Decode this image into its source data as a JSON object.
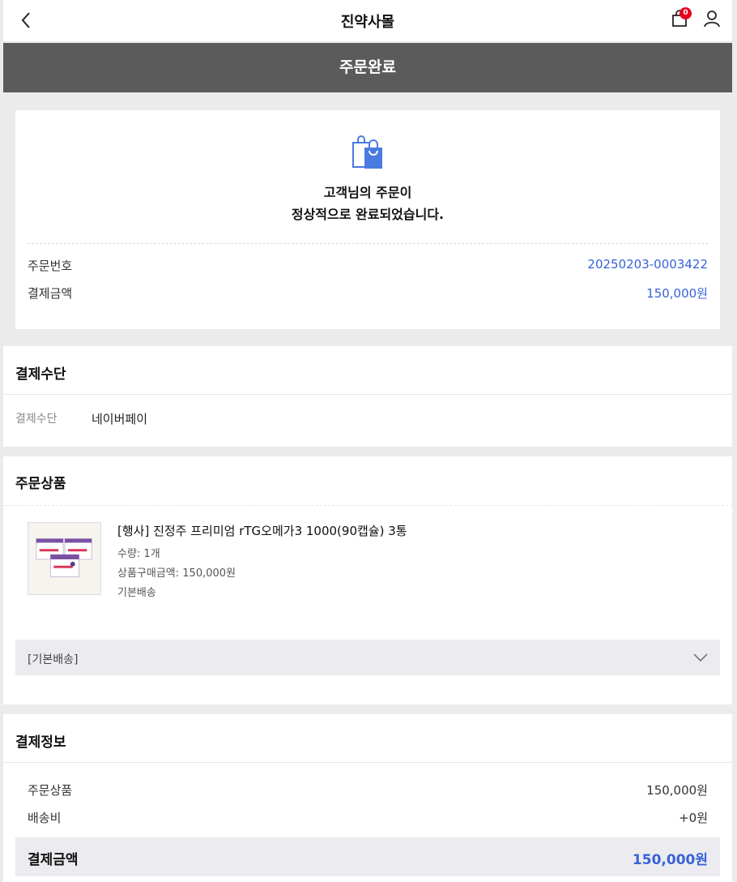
{
  "header": {
    "title": "진약사몰",
    "cart_count": "0"
  },
  "banner": {
    "title": "주문완료"
  },
  "receipt": {
    "message_line1": "고객님의 주문이",
    "message_line2": "정상적으로 완료되었습니다.",
    "order_no_label": "주문번호",
    "order_no": "20250203-0003422",
    "amount_label": "결제금액",
    "amount": "150,000원"
  },
  "payment": {
    "title": "결제수단",
    "label": "결제수단",
    "value": "네이버페이"
  },
  "products": {
    "title": "주문상품",
    "item": {
      "name": "[행사] 진정주 프리미엄 rTG오메가3 1000(90캡슐) 3통",
      "quantity": "수량: 1개",
      "price": "상품구매금액: 150,000원",
      "shipping": "기본배송"
    },
    "shipping_group": "[기본배송]"
  },
  "summary": {
    "title": "결제정보",
    "rows": [
      {
        "label": "주문상품",
        "value": "150,000원"
      },
      {
        "label": "배송비",
        "value": "+0원"
      }
    ],
    "total_label": "결제금액",
    "total_value": "150,000원"
  },
  "colors": {
    "accent": "#3763d8",
    "banner": "#5b5b5b",
    "badge": "#e8001c"
  },
  "icons": [
    "back-arrow-icon",
    "cart-icon",
    "user-icon",
    "shopping-bag-icon",
    "chevron-down-icon"
  ]
}
